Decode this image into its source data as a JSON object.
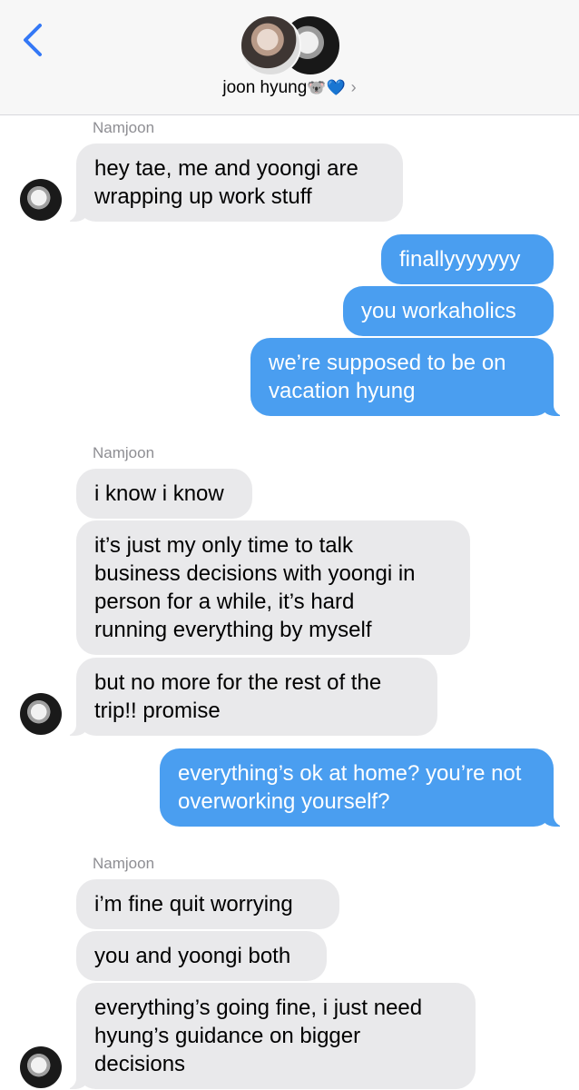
{
  "header": {
    "back_icon": "chevron-left-icon",
    "contact_name": "joon hyung",
    "contact_emojis": "🐨💙",
    "chevron": "›",
    "accent_color": "#3478f6"
  },
  "colors": {
    "incoming_bubble": "#e9e9eb",
    "outgoing_bubble": "#4a9ef0",
    "sender_label": "#8e8e93"
  },
  "messages": [
    {
      "sender": "Namjoon"
    },
    {
      "text": "hey tae, me and yoongi are\nwrapping up work stuff"
    },
    {
      "text": "finallyyyyyyy"
    },
    {
      "text": "you workaholics"
    },
    {
      "text": "we’re supposed to be on\nvacation hyung"
    },
    {
      "sender": "Namjoon"
    },
    {
      "text": "i know i know"
    },
    {
      "text": "it’s just my only time to talk\nbusiness decisions with yoongi in\nperson for a while, it’s hard\nrunning everything by myself"
    },
    {
      "text": "but no more for the rest of the\ntrip!! promise"
    },
    {
      "text": "everything’s ok at home? you’re not\noverworking yourself?"
    },
    {
      "sender": "Namjoon"
    },
    {
      "text": "i’m fine quit worrying"
    },
    {
      "text": "you and yoongi both"
    },
    {
      "text": "everything’s going fine, i just need\nhyung’s guidance on bigger\ndecisions"
    }
  ]
}
